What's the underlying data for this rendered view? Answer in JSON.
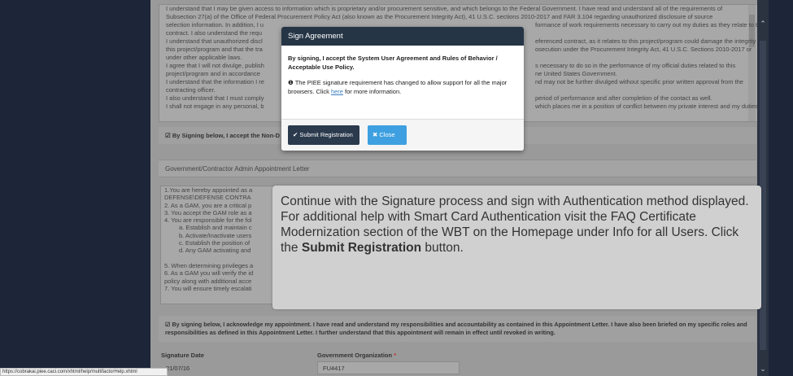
{
  "agreement": {
    "lines": [
      "I understand that I may be given access to information which is proprietary and/or procurement sensitive, and which belongs to the Federal Government. I have read and understand all of the requirements of",
      "Subsection 27(a) of the Office of Federal Procurement Policy Act (also known as the Procurement Integrity Act), 41 U.S.C. sections 2010-2017 and FAR 3.104 regarding unauthorized disclosure of source",
      "selection information. In addition, I u",
      "contract. I also understand the requ",
      "I understand that unauthorized discl",
      "this project/program and that the tra",
      "under other applicable laws.",
      "I agree that I will not divulge, publish",
      "project/program and in accordance",
      "I understand that the information I re",
      "contracting officer.",
      "I also understand that I must comply",
      "I shall not engage in any personal, b"
    ],
    "right_lines": [
      "formance of work requirements necessary to carry out my duties as they relate to this",
      "",
      "eferenced contract, as it relates to this project/program could damage the integrity of",
      "osecution under the Procurement Integrity Act, 41 U.S.C. Sections 2010-2017 or",
      "",
      "s necessary to do so in the performance of my official duties related to this",
      "ne United States Government.",
      "nd may not be further divulged without specific prior written approval from the",
      "",
      "period of performance and after completion of the contact as well.",
      "which places me in a position of conflict between my private interest and my duties or"
    ]
  },
  "nda_check": "By Signing below, I accept the Non-D",
  "appointment": {
    "title": "Government/Contractor Admin Appointment Letter",
    "lines": [
      "1.You are hereby appointed as a",
      "DEFENSE\\DEFENSE CONTRA",
      "2. As a GAM, you are a critical p",
      "3. You accept the GAM role as a",
      "4. You are responsible for the fol",
      "a. Establish and maintain c",
      "b. Activate/Inactivate users",
      "c. Establish the position of",
      "d. Any GAM activating and",
      "",
      "5. When determining privileges a",
      "6. As a GAM you will verify the id",
      "policy along with additional acce",
      "7. You will ensure timely escalati"
    ],
    "ack": "By signing below, I acknowledge my appointment. I have read and understand my responsibilities and accountability as contained in this Appointment Letter. I have also been briefed on my specific roles and responsibilities as defined in this Appointment Letter. I further understand that this appointment will remain in effect until revoked in writing."
  },
  "form": {
    "signature_date_label": "Signature Date",
    "signature_date_value": "21/07/16",
    "gov_org_label": "Government Organization",
    "gov_org_required": "*",
    "gov_org_value": "FU4417"
  },
  "instruction": {
    "text_before": "Continue with the Signature process and sign with Authentication method displayed. For additional help with Smart Card Authentication visit the FAQ Certificate Modernization section of the WBT on the Homepage under Info for all Users. Click the ",
    "bold": "Submit Registration",
    "text_after": " button."
  },
  "modal": {
    "title": "Sign Agreement",
    "statement": "By signing, I accept the System User Agreement and Rules of Behavior / Acceptable Use Policy.",
    "info_before": "The PIEE signature requirement has changed to allow support for all the major browsers. Click ",
    "info_link": "here",
    "info_after": " for more information.",
    "submit_label": "Submit Registration",
    "close_label": "Close"
  },
  "status_url": "https://cobrakai.piee.caci.com/xhtml/help/multifactorHelp.xhtml"
}
